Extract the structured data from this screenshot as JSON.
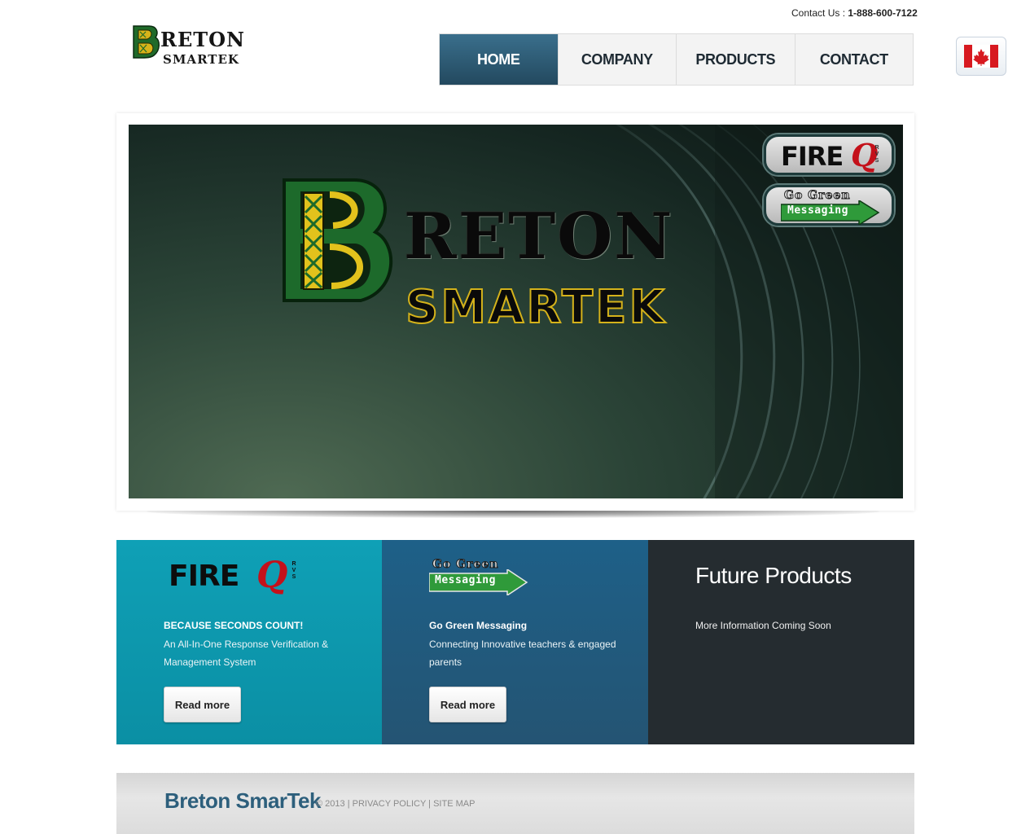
{
  "header": {
    "contact_label": "Contact Us : ",
    "phone": "1-888-600-7122",
    "logo_initial": "B",
    "logo_rest": "RETON",
    "logo_sub": "SMARTEK"
  },
  "nav": {
    "items": [
      {
        "label": "HOME",
        "active": true
      },
      {
        "label": "COMPANY"
      },
      {
        "label": "PRODUCTS"
      },
      {
        "label": "CONTACT"
      }
    ]
  },
  "flag": {
    "icon": "canada-flag-icon"
  },
  "hero": {
    "brand_rest": "RETON",
    "brand_sub": "SMARTEK",
    "badge_fire": {
      "word": "FIRE",
      "letter": "Q",
      "sub": [
        "R",
        "V",
        "S"
      ]
    },
    "badge_green": {
      "top": "Go Green",
      "bottom": "Messaging"
    }
  },
  "panels": [
    {
      "logo_word": "FIRE",
      "logo_letter": "Q",
      "logo_sub": [
        "R",
        "V",
        "S"
      ],
      "heading": "BECAUSE SECONDS COUNT!",
      "description": "An All-In-One Response Verification & Management System",
      "button": "Read more"
    },
    {
      "logo_top": "Go Green",
      "logo_bottom": "Messaging",
      "heading": "Go Green Messaging",
      "description": "Connecting Innovative teachers & engaged parents",
      "button": "Read more"
    },
    {
      "title": "Future Products",
      "text": "More Information Coming Soon"
    }
  ],
  "footer": {
    "brand": "Breton SmarTek",
    "copyright": "© 2013 | ",
    "privacy": "PRIVACY POLICY",
    "separator": " | ",
    "sitemap": "SITE MAP"
  },
  "colors": {
    "nav_active": "#2e5c76",
    "panel_fire": "#0a96ab",
    "panel_green": "#215a7d",
    "panel_future": "#252c30",
    "footer_brand": "#2d5f7c"
  }
}
